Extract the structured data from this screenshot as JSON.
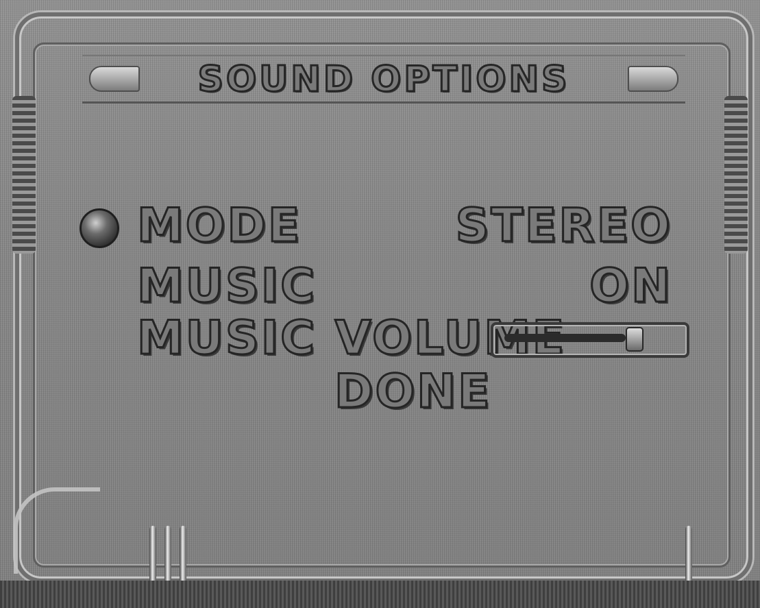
{
  "screen": {
    "title": "SOUND OPTIONS"
  },
  "menu": {
    "items": [
      {
        "label": "MODE",
        "value": "STEREO"
      },
      {
        "label": "MUSIC",
        "value": "ON"
      },
      {
        "label": "MUSIC VOLUME",
        "value": ""
      },
      {
        "label": "DONE",
        "value": ""
      }
    ],
    "selected_index": 0,
    "music_volume_level": 0.72
  },
  "colors": {
    "background": "#8d8d8d",
    "text_fill": "#7a7a7a",
    "text_outline": "#252525"
  },
  "icons": {
    "cursor": "selection-ball-icon"
  }
}
